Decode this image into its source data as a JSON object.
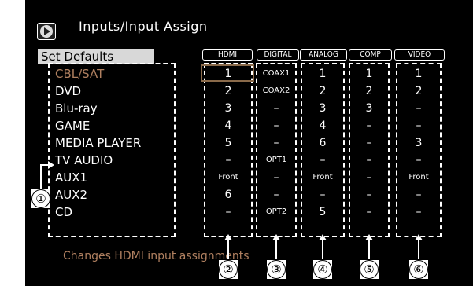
{
  "title": "Inputs/Input Assign",
  "set_defaults": "Set Defaults",
  "columns": [
    "HDMI",
    "DIGITAL",
    "ANALOG",
    "COMP",
    "VIDEO"
  ],
  "rows": [
    {
      "name": "CBL/SAT",
      "hdmi": "1",
      "digital": "COAX1",
      "analog": "1",
      "comp": "1",
      "video": "1"
    },
    {
      "name": "DVD",
      "hdmi": "2",
      "digital": "COAX2",
      "analog": "2",
      "comp": "2",
      "video": "2"
    },
    {
      "name": "Blu-ray",
      "hdmi": "3",
      "digital": "–",
      "analog": "3",
      "comp": "3",
      "video": "–"
    },
    {
      "name": "GAME",
      "hdmi": "4",
      "digital": "–",
      "analog": "4",
      "comp": "–",
      "video": "–"
    },
    {
      "name": "MEDIA PLAYER",
      "hdmi": "5",
      "digital": "–",
      "analog": "6",
      "comp": "–",
      "video": "3"
    },
    {
      "name": "TV AUDIO",
      "hdmi": "–",
      "digital": "OPT1",
      "analog": "–",
      "comp": "–",
      "video": "–"
    },
    {
      "name": "AUX1",
      "hdmi": "Front",
      "digital": "–",
      "analog": "Front",
      "comp": "–",
      "video": "Front"
    },
    {
      "name": "AUX2",
      "hdmi": "6",
      "digital": "–",
      "analog": "–",
      "comp": "–",
      "video": "–"
    },
    {
      "name": "CD",
      "hdmi": "–",
      "digital": "OPT2",
      "analog": "5",
      "comp": "–",
      "video": "–"
    }
  ],
  "footer": "Changes HDMI input assignments",
  "callouts": [
    "①",
    "②",
    "③",
    "④",
    "⑤",
    "⑥"
  ],
  "colors": {
    "background": "#000000",
    "selected_row": "#b08060",
    "text": "#ffffff"
  }
}
